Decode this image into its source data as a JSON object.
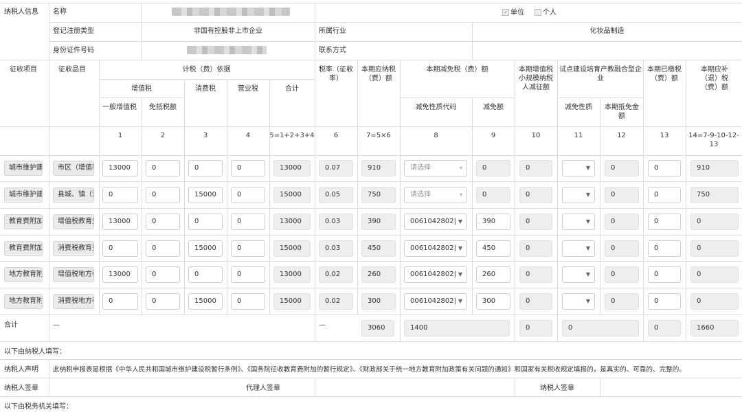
{
  "info": {
    "section_label": "纳税人信息",
    "name_label": "名称",
    "unit_label": "单位",
    "person_label": "个人",
    "reg_type_label": "登记注册类型",
    "reg_type_value": "非国有控股非上市企业",
    "industry_label": "所属行业",
    "industry_value": "化妆品制造",
    "id_label": "身份证件号码",
    "contact_label": "联系方式"
  },
  "headers": {
    "levy_item": "征收项目",
    "levy_sub": "征收品目",
    "basis": "计税（费）依据",
    "vat": "增值税",
    "vat_general": "一般增值税",
    "vat_exempt": "免抵税额",
    "consumption": "消费税",
    "business": "营业税",
    "total": "合计",
    "rate": "税率（征收率）",
    "payable": "本期应纳税（费）额",
    "reduction": "本期减免税（费）额",
    "reduction_code": "减免性质代码",
    "reduction_amount": "减免额",
    "small_scale": "本期增值税小规模纳税人减征额",
    "pilot": "试点建设培育产教融合型企业",
    "pilot_nature": "减免性质",
    "pilot_deduct": "本期抵免金额",
    "paid": "本期已缴税（费）额",
    "refund": "本期应补（退）税（费）额"
  },
  "col_numbers": [
    "1",
    "2",
    "3",
    "4",
    "5=1+2+3+4",
    "6",
    "7=5×6",
    "8",
    "9",
    "10",
    "11",
    "12",
    "13",
    "14=7-9-10-12-13"
  ],
  "rows": [
    {
      "item": "城市维护建设税",
      "sub": "市区（增值税附征）",
      "c1": "13000",
      "c2": "0",
      "c3": "0",
      "c4": "0",
      "c5": "13000",
      "c6": "0.07",
      "c7": "910",
      "c8": "请选择",
      "c8_placeholder": true,
      "c9": "0",
      "c10": "0",
      "c12": "0",
      "c13": "0",
      "c14": "910"
    },
    {
      "item": "城市维护建设税",
      "sub": "县城、镇（消费税附征）",
      "c1": "0",
      "c2": "0",
      "c3": "15000",
      "c4": "0",
      "c5": "15000",
      "c6": "0.05",
      "c7": "750",
      "c8": "请选择",
      "c8_placeholder": true,
      "c9": "0",
      "c10": "0",
      "c12": "0",
      "c13": "0",
      "c14": "750"
    },
    {
      "item": "教育费附加",
      "sub": "增值税教育费附加",
      "c1": "13000",
      "c2": "0",
      "c3": "0",
      "c4": "0",
      "c5": "13000",
      "c6": "0.03",
      "c7": "390",
      "c8": "0061042802|",
      "c8_placeholder": false,
      "c9": "390",
      "c10": "0",
      "c12": "0",
      "c13": "0",
      "c14": "0"
    },
    {
      "item": "教育费附加",
      "sub": "消费税教育费附加",
      "c1": "0",
      "c2": "0",
      "c3": "15000",
      "c4": "0",
      "c5": "15000",
      "c6": "0.03",
      "c7": "450",
      "c8": "0061042802|",
      "c8_placeholder": false,
      "c9": "450",
      "c10": "0",
      "c12": "0",
      "c13": "0",
      "c14": "0"
    },
    {
      "item": "地方教育附加",
      "sub": "增值税地方教育附加",
      "c1": "13000",
      "c2": "0",
      "c3": "0",
      "c4": "0",
      "c5": "13000",
      "c6": "0.02",
      "c7": "260",
      "c8": "0061042802|",
      "c8_placeholder": false,
      "c9": "260",
      "c10": "0",
      "c12": "0",
      "c13": "0",
      "c14": "0"
    },
    {
      "item": "地方教育附加",
      "sub": "消费税地方教育附加",
      "c1": "0",
      "c2": "0",
      "c3": "15000",
      "c4": "0",
      "c5": "15000",
      "c6": "0.02",
      "c7": "300",
      "c8": "0061042802|",
      "c8_placeholder": false,
      "c9": "300",
      "c10": "0",
      "c12": "0",
      "c13": "0",
      "c14": "0"
    }
  ],
  "totals": {
    "label": "合计",
    "dash1": "—",
    "dash2": "—",
    "payable": "3060",
    "reduction": "1400",
    "small_scale": "0",
    "pilot_deduct": "0",
    "paid": "0",
    "refund": "1660"
  },
  "footer": {
    "fill_by_taxpayer": "以下由纳税人填写：",
    "declaration_label": "纳税人声明",
    "declaration_text": "此纳税申报表是根据《中华人民共和国城市维护建设税暂行条例》、《国务院征收教育费附加的暂行规定》、《财政部关于统一地方教育附加政策有关问题的通知》和国家有关税收规定填报的，是真实的、可靠的、完整的。",
    "taxpayer_sign": "纳税人签章",
    "agent_sign": "代理人签章",
    "taxpayer_sign2": "纳税人签章",
    "fill_by_office": "以下由税务机关填写："
  },
  "colors": {
    "border": "#dcdcdc",
    "readonly": "#eeeeee",
    "button": "#ebebeb"
  }
}
